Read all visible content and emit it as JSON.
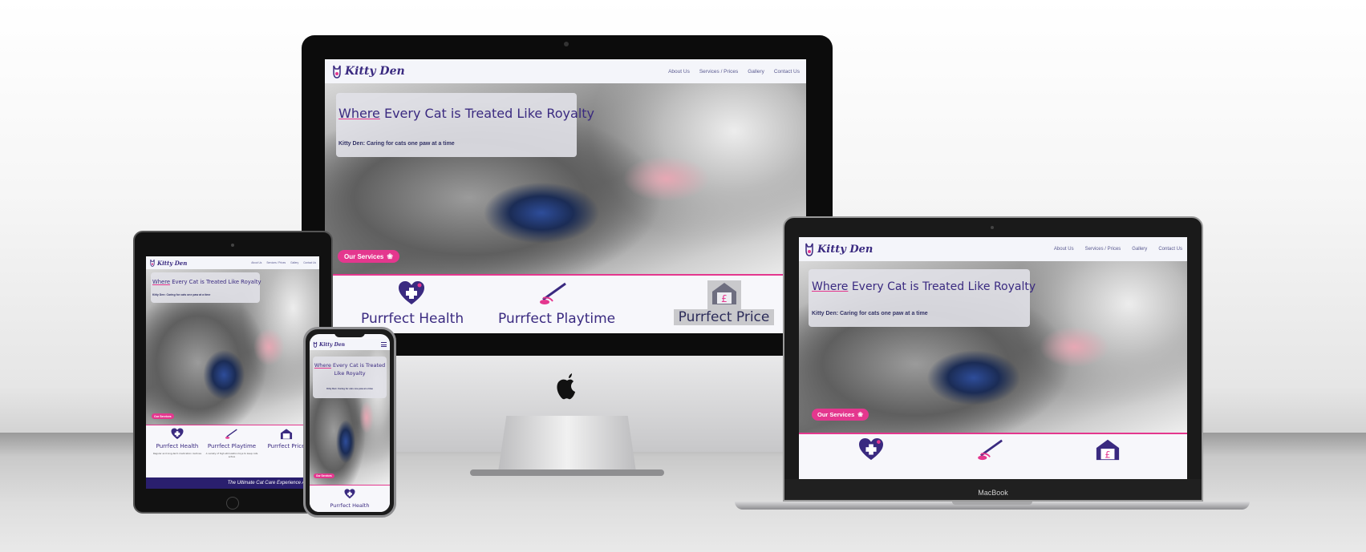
{
  "site": {
    "brand": "Kitty Den",
    "nav": [
      "About Us",
      "Services / Prices",
      "Gallery",
      "Contact Us"
    ],
    "hero_title_prefix": "Where",
    "hero_title_rest": " Every Cat is Treated Like Royalty",
    "hero_subtitle": "Kitty Den: Caring for cats one paw at a time",
    "cta_label": "Our Services",
    "services": [
      {
        "title": "Purrfect Health",
        "icon": "medical-heart-icon",
        "desc": "Regular and long-term medication routines"
      },
      {
        "title": "Purrfect Playtime",
        "icon": "cat-toy-wand-icon",
        "desc": "A variety of high-stimulation toys to keep cats active"
      },
      {
        "title": "Purrfect Price",
        "icon": "pound-house-icon",
        "desc": ""
      }
    ],
    "tagline_banner": "The Ultimate Cat Care Experience Awaits"
  },
  "devices": {
    "laptop_label": "MacBook"
  },
  "colors": {
    "brand_purple": "#3a2a80",
    "accent_pink": "#e4378e",
    "nav_bg": "#f4f5fa"
  }
}
